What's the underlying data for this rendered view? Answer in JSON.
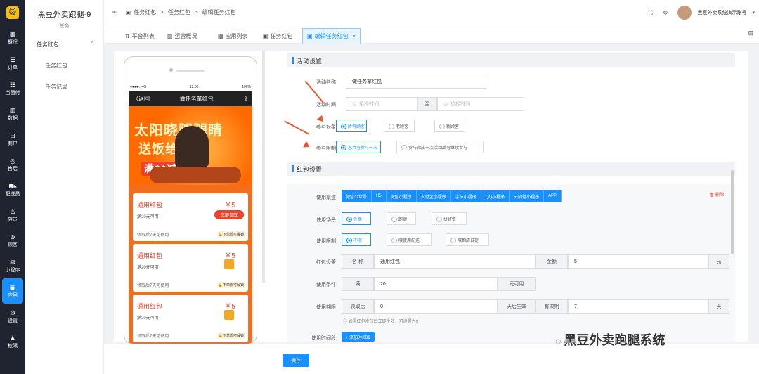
{
  "sidebar": {
    "logo": "😺",
    "items": [
      {
        "icon": "▦",
        "label": "概况"
      },
      {
        "icon": "☰",
        "label": "订单"
      },
      {
        "icon": "☷",
        "label": "当面付"
      },
      {
        "icon": "▥",
        "label": "数据"
      },
      {
        "icon": "⊟",
        "label": "商户"
      },
      {
        "icon": "◎",
        "label": "售后"
      },
      {
        "icon": "⛟",
        "label": "配送员"
      },
      {
        "icon": "♙",
        "label": "店员"
      },
      {
        "icon": "⊚",
        "label": "顾客"
      },
      {
        "icon": "✉",
        "label": "小程序"
      },
      {
        "icon": "▣",
        "label": "应用"
      },
      {
        "icon": "⚙",
        "label": "设置"
      },
      {
        "icon": "♟",
        "label": "权限"
      }
    ]
  },
  "subside": {
    "store_name": "黑豆外卖跑腿-9",
    "store_sub": "任务",
    "group_label": "任务红包",
    "group_chevron": "^",
    "items": [
      "任务红包",
      "任务记录"
    ]
  },
  "topbar": {
    "crumbs": [
      "任务红包",
      "任务红包",
      "编辑任务红包"
    ],
    "user": "黑豆外卖系统演示账号"
  },
  "tabs": [
    "平台列表",
    "运营概况",
    "应用列表",
    "任务红包",
    "编辑任务红包"
  ],
  "phone": {
    "carrier": "●●●●○ 4G",
    "time": "12:00",
    "battery": "100%",
    "back": "〈返回",
    "title": "做任务拿红包",
    "banner_line1": "太阳晓腿腿睛",
    "banner_line2": "送饭给你",
    "banner_line3": "满30减15",
    "coupons": [
      {
        "title": "通用红包",
        "value": "￥5",
        "desc": "满20元可用",
        "foot": "领取后7天可使用",
        "tag": "🔒下单即可解锁",
        "button": "立即领取"
      },
      {
        "title": "通用红包",
        "value": "￥5",
        "desc": "满20元可用",
        "foot": "领取后7天可使用",
        "tag": "🔒下单即可解锁"
      },
      {
        "title": "通用红包",
        "value": "￥5",
        "desc": "满20元可用",
        "foot": "领取后7天可使用",
        "tag": "🔒下单即可解锁"
      }
    ]
  },
  "activity": {
    "section": "活动设置",
    "name_label": "活动名称",
    "name_value": "做任务拿红包",
    "time_label": "活动时间",
    "time_start_ph": "选择时间",
    "time_sep": "至",
    "time_end_ph": "选择时间",
    "target_label": "参与对象",
    "targets": [
      "所有顾客",
      "老顾客",
      "新顾客"
    ],
    "limit_label": "参与限制",
    "limits": [
      "总共可参与一次",
      "参与完成一次活动后可继续参与"
    ]
  },
  "redpack": {
    "section": "红包设置",
    "delete": "🗑 删除",
    "channel_label": "使用渠道",
    "channels": [
      "微信公众号",
      "H5",
      "微信小程序",
      "支付宝小程序",
      "字节小程序",
      "QQ小程序",
      "云闪付小程序",
      "APP"
    ],
    "scene_label": "使用场景",
    "scenes": [
      "外卖",
      "跑腿",
      "拼好饭"
    ],
    "restrict_label": "使用限制",
    "restricts": [
      "不限",
      "限使用配送",
      "限到店自提"
    ],
    "setting_label": "红包设置",
    "name_addon": "名 称",
    "name_value": "通用红包",
    "amount_addon": "金额",
    "amount_value": "5",
    "amount_unit": "元",
    "cond_label": "使用条件",
    "cond_addon": "满",
    "cond_value": "20",
    "cond_unit": "元可用",
    "period_label": "使用期限",
    "period_addon": "领取后",
    "period_value": "0",
    "period_unit": "天后生效",
    "valid_addon": "有效期",
    "valid_value": "7",
    "valid_unit": "天",
    "note": "ⓘ 如需红包发放后立即生效，可设置为0",
    "timeslot_label": "使用时间段",
    "timeslot_button": "+ 添加时间段"
  },
  "save": "保存",
  "watermark": "黑豆外卖跑腿系统"
}
